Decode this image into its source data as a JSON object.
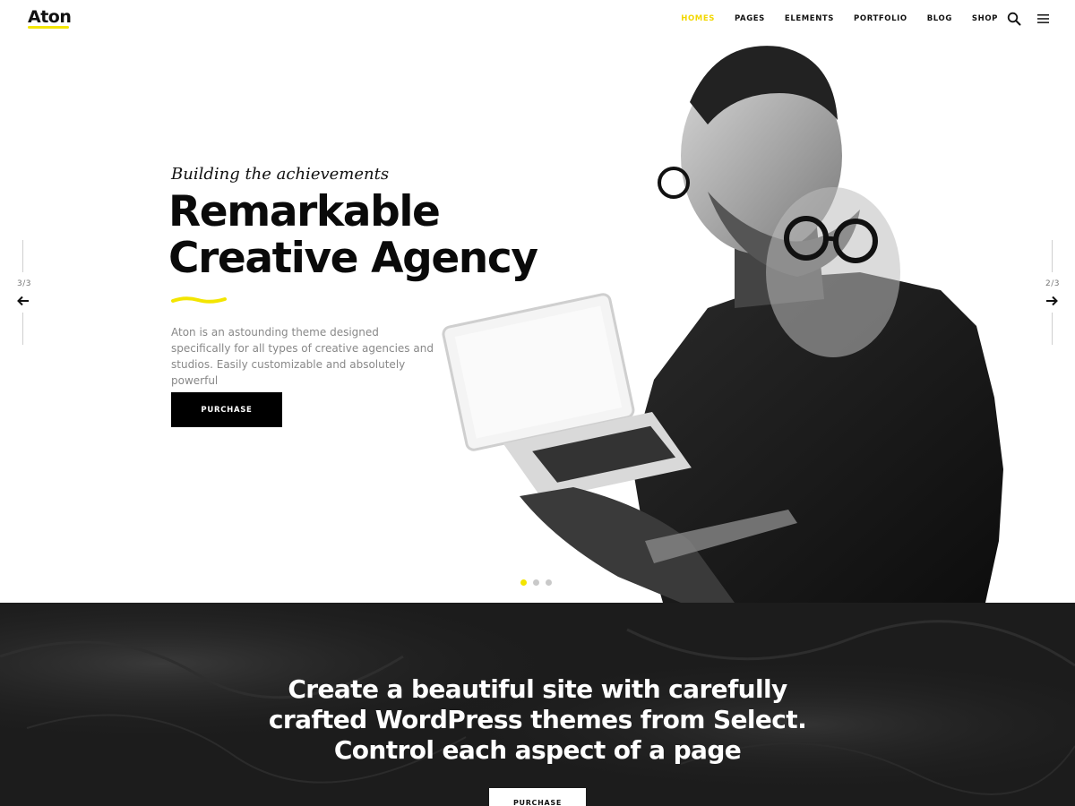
{
  "header": {
    "logo": "Aton",
    "nav": [
      {
        "label": "HOMES",
        "active": true
      },
      {
        "label": "PAGES",
        "active": false
      },
      {
        "label": "ELEMENTS",
        "active": false
      },
      {
        "label": "PORTFOLIO",
        "active": false
      },
      {
        "label": "BLOG",
        "active": false
      },
      {
        "label": "SHOP",
        "active": false
      }
    ],
    "icons": [
      "search-icon",
      "hamburger-menu-icon"
    ]
  },
  "hero": {
    "prev_counter": "3/3",
    "next_counter": "2/3",
    "kicker": "Building the achievements",
    "title_line1": "Remarkable",
    "title_line2": "Creative Agency",
    "description": "Aton is an astounding theme designed specifically for all types of creative agencies and studios. Easily customizable and absolutely powerful",
    "button_label": "PURCHASE",
    "slides_total": 3,
    "slide_active": 1
  },
  "cta": {
    "headline_line1": "Create a beautiful site with carefully",
    "headline_line2": "crafted WordPress themes from Select.",
    "headline_line3": "Control each aspect of a page",
    "button_label": "PURCHASE"
  },
  "colors": {
    "accent": "#f3e500",
    "dark_bg": "#1c1c1c",
    "button_bg": "#000000"
  }
}
